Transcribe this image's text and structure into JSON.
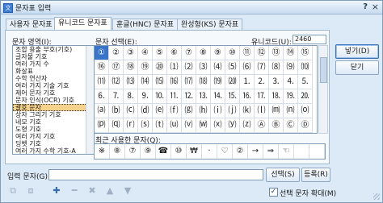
{
  "window": {
    "title": "문자표 입력",
    "help": "?",
    "close": "×"
  },
  "tabs": [
    "사용자 문자표",
    "유니코드 문자표",
    "훈글(HNC) 문자표",
    "완성형(KS) 문자표"
  ],
  "active_tab": 1,
  "labels": {
    "area": "문자 영역(I):",
    "select": "문자 선택(E):",
    "unicode": "유니코드(U):",
    "recent": "최근 사용한 문자(Q):",
    "input": "입력 문자(G):"
  },
  "unicode_value": "2460",
  "area_list": {
    "items": [
      "조합 용출 부호(기호)",
      "글자물 기호",
      "여러 가지 수",
      "화살표",
      "수학 연산자",
      "여러 가지 기술 기호",
      "제어 문자 기호",
      "문자 인식(OCR) 기호",
      "괄호 문자",
      "상자 그리기 기호",
      "네모 기호",
      "도형 기호",
      "여러 가지 기호",
      "딩벳 기호",
      "여러 가지 수학 기호-A"
    ],
    "selected_index": 8
  },
  "char_grid": [
    "①",
    "②",
    "③",
    "④",
    "⑤",
    "⑥",
    "⑦",
    "⑧",
    "⑨",
    "⑩",
    "⑪",
    "⑫",
    "⑬",
    "⑭",
    "⑮",
    "⑯",
    "⑰",
    "⑱",
    "⑲",
    "⑳",
    "⑴",
    "⑵",
    "⑶",
    "⑷",
    "⑸",
    "⑹",
    "⑺",
    "⑻",
    "⑼",
    "⑽",
    "⑾",
    "⑿",
    "⒀",
    "⒁",
    "⒂",
    "⒃",
    "⒄",
    "⒅",
    "⒆",
    "⒇",
    "⒈",
    "⒉",
    "⒊",
    "⒋",
    "⒌",
    "⒍",
    "⒎",
    "⒏",
    "⒐",
    "⒑",
    "⒒",
    "⒓",
    "⒔",
    "⒕",
    "⒖",
    "⒗",
    "⒘",
    "⒙",
    "⒚",
    "⒛",
    "⒜",
    "⒝",
    "⒞",
    "⒟",
    "⒠",
    "⒡",
    "⒢",
    "⒣",
    "⒤",
    "⒥",
    "⒦",
    "⒧",
    "⒨",
    "⒩",
    "⒪",
    "⒫",
    "⒬",
    "⒭",
    "⒮",
    "⒯",
    "⒰",
    "⒱",
    "⒲",
    "⒳",
    "⒴",
    "⒵",
    "Ⓐ",
    "Ⓑ",
    "Ⓒ",
    "Ⓓ"
  ],
  "selected_char_index": 0,
  "recent_chars": [
    "※",
    "⑧",
    "⑦",
    "⑨",
    "☎",
    "⑩",
    "₩",
    "·",
    "♡",
    "②",
    "→",
    "⇒",
    "☜",
    "",
    ""
  ],
  "buttons": {
    "insert": "넣기(D)",
    "close": "닫기",
    "select": "선택(S)",
    "register": "등록(R)",
    "enlarge_label": "선택 문자 확대(M)"
  },
  "enlarge_checked": "✓",
  "toolbar_icons": [
    "sheet-add-icon",
    "sheet-remove-icon",
    "plus-icon",
    "minus-icon",
    "delete-icon",
    "up-icon",
    "down-icon"
  ]
}
